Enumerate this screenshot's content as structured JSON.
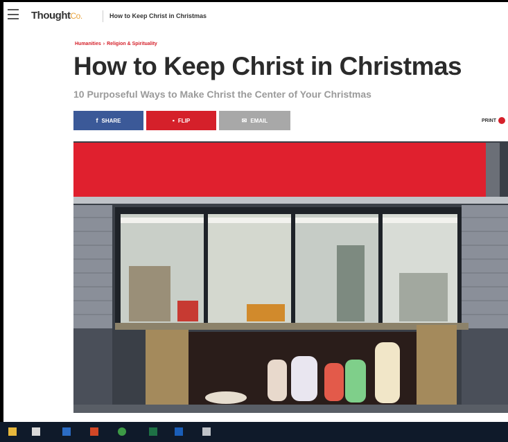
{
  "header": {
    "logo_main": "Thought",
    "logo_co": "Co.",
    "page_title": "How to Keep Christ in Christmas"
  },
  "breadcrumb": {
    "items": [
      "Humanities",
      "Religion & Spirituality"
    ],
    "separator": "›"
  },
  "article": {
    "title": "How to Keep Christ in Christmas",
    "subtitle": "10 Purposeful Ways to Make Christ the Center of Your Christmas"
  },
  "share": {
    "share_label": "SHARE",
    "flip_label": "FLIP",
    "email_label": "EMAIL",
    "print_label": "PRINT"
  },
  "colors": {
    "accent_red": "#d5202a",
    "facebook_blue": "#3b5998",
    "email_gray": "#a8a8a8",
    "taskbar": "#0f1a2a"
  },
  "icons": [
    "menu-icon",
    "facebook-icon",
    "flipboard-icon",
    "email-icon",
    "print-icon"
  ],
  "taskbar": {
    "apps": [
      "file-explorer-icon",
      "store-icon",
      "word-icon",
      "powerpoint-icon",
      "chrome-icon",
      "excel-icon",
      "outlook-icon",
      "calculator-icon"
    ]
  }
}
